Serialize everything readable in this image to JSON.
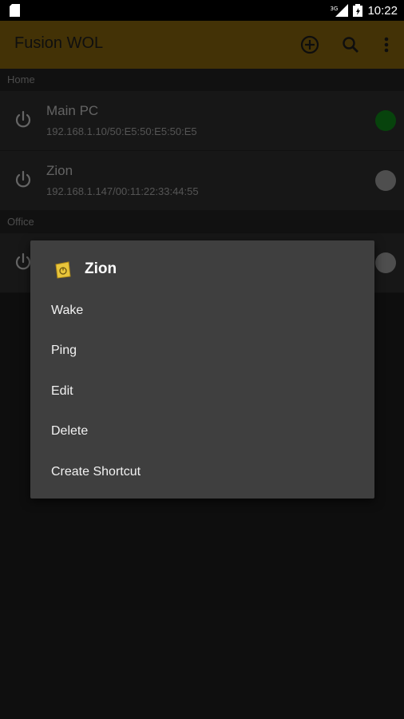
{
  "status_bar": {
    "time": "10:22",
    "network": "3G"
  },
  "app_bar": {
    "title": "Fusion WOL",
    "color": "#7a5b0c"
  },
  "sections": [
    {
      "label": "Home",
      "devices": [
        {
          "name": "Main PC",
          "address": "192.168.1.10/50:E5:50:E5:50:E5",
          "online": true
        },
        {
          "name": "Zion",
          "address": "192.168.1.147/00:11:22:33:44:55",
          "online": false
        }
      ]
    },
    {
      "label": "Office",
      "devices": [
        {
          "name": "",
          "address": "",
          "online": false
        }
      ]
    }
  ],
  "context_menu": {
    "title": "Zion",
    "items": [
      "Wake",
      "Ping",
      "Edit",
      "Delete",
      "Create Shortcut"
    ]
  },
  "colors": {
    "online": "#0e7a16",
    "offline": "#8e8e8e",
    "accent": "#7a5b0c",
    "menu_bg": "#3f3f3f"
  },
  "icons": {
    "app_bar_actions": [
      "add-circle-icon",
      "search-icon",
      "overflow-menu-icon"
    ],
    "row_icon": "power-icon"
  }
}
